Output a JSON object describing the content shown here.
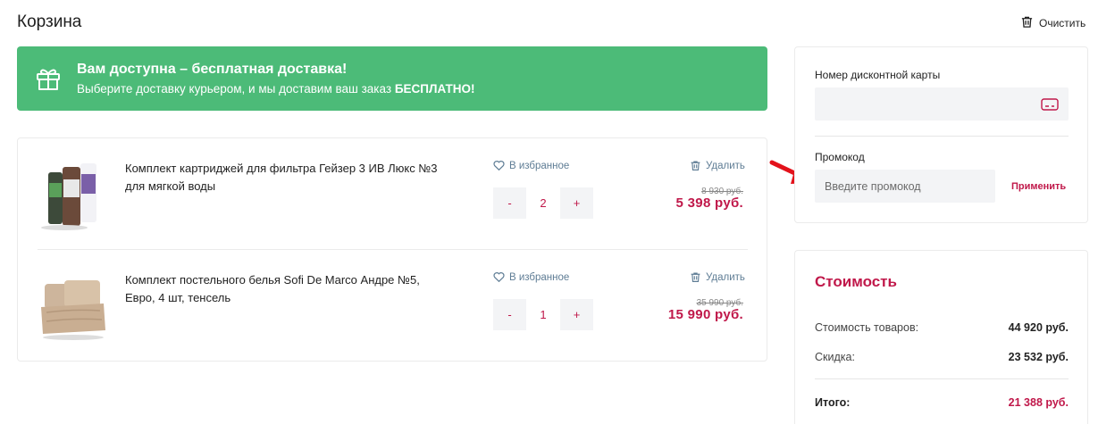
{
  "header": {
    "title": "Корзина",
    "clear_label": "Очистить"
  },
  "banner": {
    "title": "Вам доступна – бесплатная доставка!",
    "text": "Выберите доставку курьером, и мы доставим ваш заказ ",
    "text_bold": "БЕСПЛАТНО!",
    "color": "#4cbb78"
  },
  "cart": {
    "favorite_label": "В избранное",
    "delete_label": "Удалить",
    "items": [
      {
        "name": "Комплект картриджей для фильтра Гейзер 3 ИВ Люкс №3 для мягкой воды",
        "qty_minus": "-",
        "qty": "2",
        "qty_plus": "+",
        "old_price": "8 930 руб.",
        "price": "5 398 руб."
      },
      {
        "name": "Комплект постельного белья Sofi De Marco Андре №5, Евро, 4 шт, тенсель",
        "qty_minus": "-",
        "qty": "1",
        "qty_plus": "+",
        "old_price": "35 990 руб.",
        "price": "15 990 руб."
      }
    ]
  },
  "discount": {
    "card_label": "Номер дисконтной карты",
    "card_value": "",
    "promo_label": "Промокод",
    "promo_placeholder": "Введите промокод",
    "apply_label": "Применить"
  },
  "cost": {
    "title": "Стоимость",
    "goods_label": "Стоимость товаров:",
    "goods_value": "44 920 руб.",
    "discount_label": "Скидка:",
    "discount_value": "23 532 руб.",
    "total_label": "Итого:",
    "total_value": "21 388 руб."
  },
  "colors": {
    "accent": "#c0184a",
    "link": "#5f7d95"
  }
}
